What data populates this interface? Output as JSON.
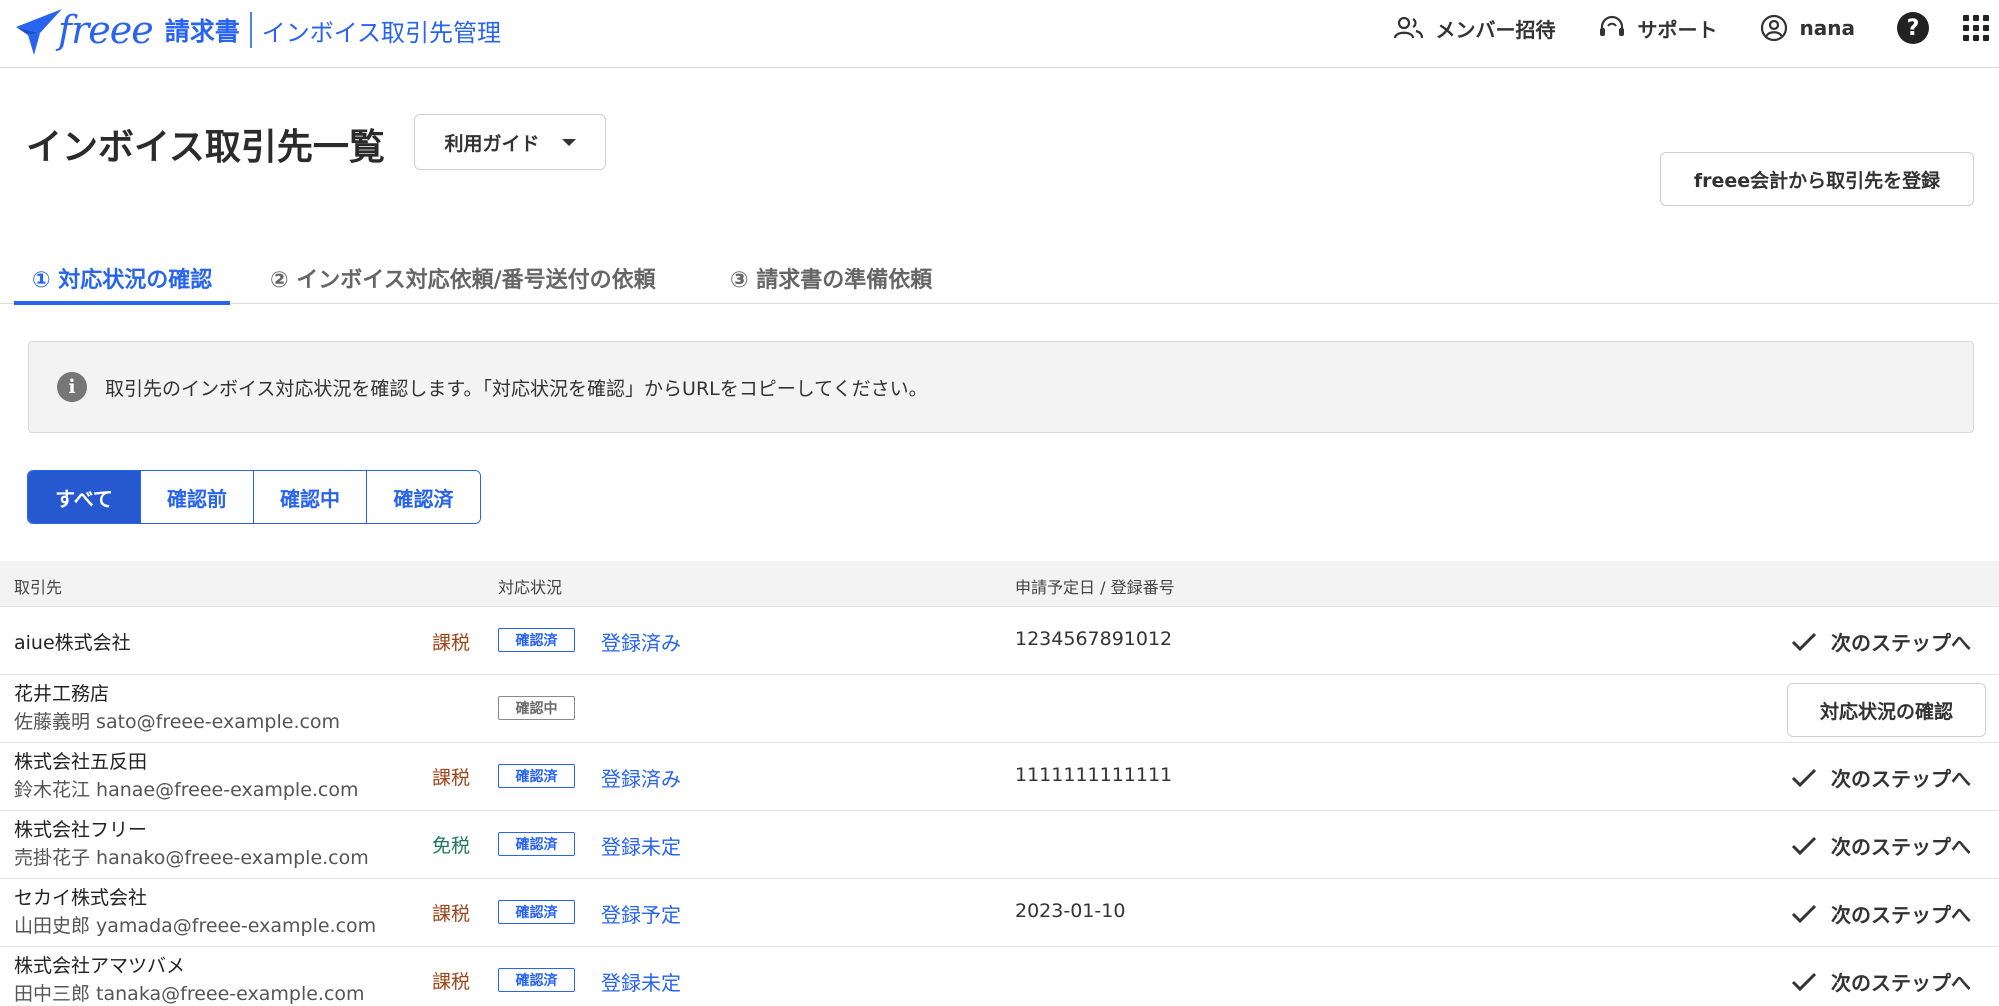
{
  "header": {
    "brand": "freee",
    "product": "請求書",
    "section": "インボイス取引先管理",
    "invite": "メンバー招待",
    "support": "サポート",
    "user": "nana",
    "help": "?"
  },
  "page": {
    "title": "インボイス取引先一覧",
    "guide_label": "利用ガイド",
    "register_label": "freee会計から取引先を登録"
  },
  "tabs": [
    {
      "label": "① 対応状況の確認"
    },
    {
      "label": "② インボイス対応依頼/番号送付の依頼"
    },
    {
      "label": "③ 請求書の準備依頼"
    }
  ],
  "info": {
    "icon": "i",
    "text": "取引先のインボイス対応状況を確認します。「対応状況を確認」からURLをコピーしてください。"
  },
  "filters": [
    {
      "label": "すべて"
    },
    {
      "label": "確認前"
    },
    {
      "label": "確認中"
    },
    {
      "label": "確認済"
    }
  ],
  "table": {
    "headers": {
      "partner": "取引先",
      "status": "対応状況",
      "date_number": "申請予定日 / 登録番号"
    },
    "next_label": "次のステップへ",
    "confirm_label": "対応状況の確認",
    "rows": [
      {
        "name": "aiue株式会社",
        "contact": "",
        "tax": "課税",
        "badge": "確認済",
        "reg": "登録済み",
        "number": "1234567891012"
      },
      {
        "name": "花井工務店",
        "contact": "佐藤義明 sato@freee-example.com",
        "tax": "",
        "badge": "確認中",
        "reg": "",
        "number": ""
      },
      {
        "name": "株式会社五反田",
        "contact": "鈴木花江 hanae@freee-example.com",
        "tax": "課税",
        "badge": "確認済",
        "reg": "登録済み",
        "number": "1111111111111"
      },
      {
        "name": "株式会社フリー",
        "contact": "売掛花子 hanako@freee-example.com",
        "tax": "免税",
        "badge": "確認済",
        "reg": "登録未定",
        "number": ""
      },
      {
        "name": "セカイ株式会社",
        "contact": "山田史郎 yamada@freee-example.com",
        "tax": "課税",
        "badge": "確認済",
        "reg": "登録予定",
        "number": "2023-01-10"
      },
      {
        "name": "株式会社アマツバメ",
        "contact": "田中三郎 tanaka@freee-example.com",
        "tax": "課税",
        "badge": "確認済",
        "reg": "登録未定",
        "number": ""
      }
    ]
  }
}
